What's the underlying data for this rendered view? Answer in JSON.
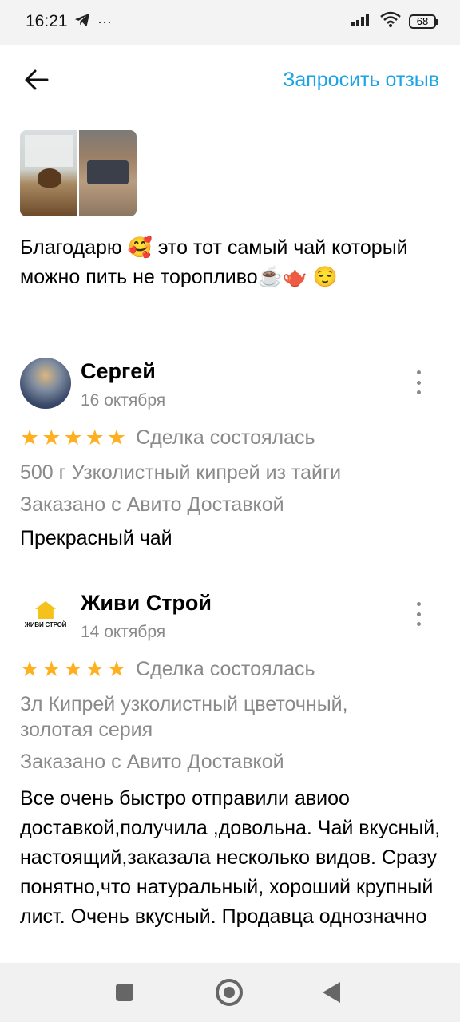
{
  "status_bar": {
    "time": "16:21",
    "extra": "···",
    "battery": "68"
  },
  "header": {
    "request_review": "Запросить отзыв"
  },
  "first_review": {
    "text": "Благодарю 🥰 это тот самый чай который можно пить не торопливо☕🫖 😌"
  },
  "reviews": [
    {
      "name": "Сергей",
      "date": "16 октября",
      "rating": 5,
      "deal_status": "Сделка состоялась",
      "item": "500 г Узколистный кипрей из тайги",
      "delivery": "Заказано с Авито Доставкой",
      "text": "Прекрасный чай"
    },
    {
      "name": "Живи Строй",
      "avatar_logo_text": "ЖИВИ СТРОЙ",
      "date": "14 октября",
      "rating": 5,
      "deal_status": "Сделка состоялась",
      "item": "3л Кипрей узколистный цветочный, золотая серия",
      "delivery": "Заказано с Авито Доставкой",
      "text": "Все очень быстро отправили авиоо доставкой,получила ,довольна.  Чай вкусный, настоящий,заказала несколько видов. Сразу понятно,что натуральный, хороший крупный лист. Очень вкусный.  Продавца однозначно"
    }
  ],
  "icons": {
    "back": "arrow-left-icon",
    "telegram": "telegram-icon",
    "signal": "signal-icon",
    "wifi": "wifi-icon",
    "battery": "battery-icon",
    "more": "more-vertical-icon",
    "star": "star-icon",
    "nav_recents": "square-icon",
    "nav_home": "circle-icon",
    "nav_back": "triangle-back-icon"
  },
  "colors": {
    "accent": "#1aa3e6",
    "star": "#ffb021",
    "muted": "#8a8a8a"
  }
}
